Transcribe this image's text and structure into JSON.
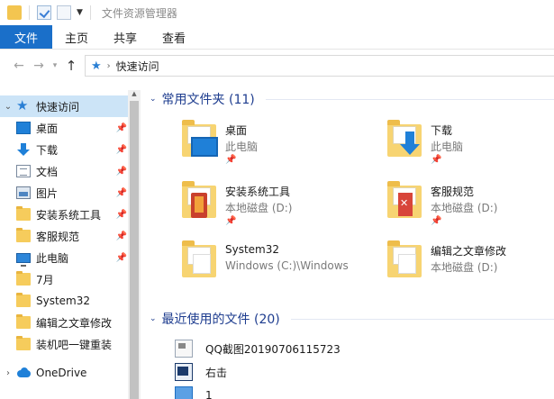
{
  "window": {
    "title": "文件资源管理器"
  },
  "ribbon": {
    "tabs": [
      {
        "label": "文件",
        "active": true
      },
      {
        "label": "主页"
      },
      {
        "label": "共享"
      },
      {
        "label": "查看"
      }
    ]
  },
  "address": {
    "path": "快速访问",
    "icon": "star-icon"
  },
  "nav": {
    "items": [
      {
        "label": "快速访问",
        "icon": "star-icon",
        "selected": true,
        "expanded": true
      },
      {
        "label": "桌面",
        "icon": "desktop-icon",
        "pinned": true
      },
      {
        "label": "下载",
        "icon": "download-icon",
        "pinned": true
      },
      {
        "label": "文档",
        "icon": "documents-icon",
        "pinned": true
      },
      {
        "label": "图片",
        "icon": "pictures-icon",
        "pinned": true
      },
      {
        "label": "安装系统工具",
        "icon": "folder-icon",
        "pinned": true
      },
      {
        "label": "客服规范",
        "icon": "folder-icon",
        "pinned": true
      },
      {
        "label": "此电脑",
        "icon": "computer-icon",
        "pinned": true
      },
      {
        "label": "7月",
        "icon": "folder-icon"
      },
      {
        "label": "System32",
        "icon": "folder-icon"
      },
      {
        "label": "编辑之文章修改",
        "icon": "folder-icon"
      },
      {
        "label": "装机吧一键重装",
        "icon": "folder-icon"
      },
      {
        "label": "OneDrive",
        "icon": "cloud-icon"
      }
    ]
  },
  "frequent": {
    "header": "常用文件夹 (11)",
    "tiles": [
      {
        "name": "桌面",
        "sub": "此电脑",
        "pinned": true,
        "icon": "desktop-folder-icon"
      },
      {
        "name": "下载",
        "sub": "此电脑",
        "pinned": true,
        "icon": "download-folder-icon"
      },
      {
        "name": "安装系统工具",
        "sub": "本地磁盘 (D:)",
        "pinned": true,
        "icon": "tools-folder-icon"
      },
      {
        "name": "客服规范",
        "sub": "本地磁盘 (D:)",
        "pinned": true,
        "icon": "office-folder-icon"
      },
      {
        "name": "System32",
        "sub": "Windows (C:)\\Windows",
        "pinned": false,
        "icon": "folder-icon"
      },
      {
        "name": "编辑之文章修改",
        "sub": "本地磁盘 (D:)",
        "pinned": false,
        "icon": "folder-icon"
      }
    ]
  },
  "recent": {
    "header": "最近使用的文件 (20)",
    "files": [
      {
        "name": "QQ截图20190706115723",
        "icon": "image-file-icon"
      },
      {
        "name": "右击",
        "icon": "document-file-icon"
      },
      {
        "name": "1",
        "icon": "blue-file-icon"
      }
    ]
  },
  "colors": {
    "accent": "#1a6fc9",
    "header_text": "#1e3d8f",
    "selected": "#cce4f7"
  }
}
